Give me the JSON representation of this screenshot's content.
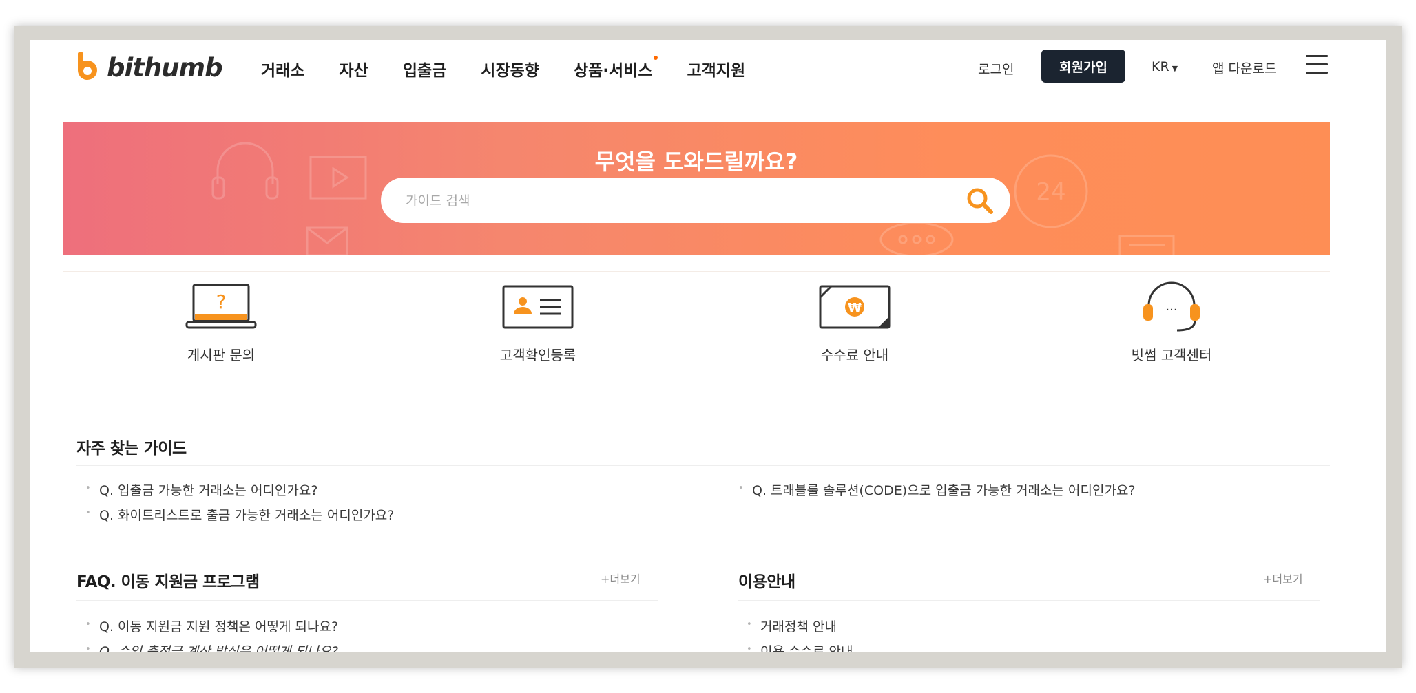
{
  "header": {
    "logo_text": "bithumb",
    "nav": [
      "거래소",
      "자산",
      "입출금",
      "시장동향",
      "상품·서비스",
      "고객지원"
    ],
    "login": "로그인",
    "join": "회원가입",
    "lang": "KR",
    "app_download": "앱 다운로드"
  },
  "banner": {
    "title": "무엇을 도와드릴까요?",
    "search_placeholder": "가이드 검색"
  },
  "quick_links": [
    {
      "label": "게시판 문의",
      "icon": "laptop-question-icon"
    },
    {
      "label": "고객확인등록",
      "icon": "id-card-icon"
    },
    {
      "label": "수수료 안내",
      "icon": "won-bill-icon"
    },
    {
      "label": "빗썸 고객센터",
      "icon": "headset-icon"
    }
  ],
  "frequent_guides": {
    "title": "자주 찾는 가이드",
    "left": [
      "Q. 입출금 가능한 거래소는 어디인가요?",
      "Q. 화이트리스트로 출금 가능한 거래소는 어디인가요?"
    ],
    "right": [
      "Q. 트래블룰 솔루션(CODE)으로 입출금 가능한 거래소는 어디인가요?"
    ]
  },
  "faq": {
    "title": "FAQ. 이동 지원금 프로그램",
    "more": "+더보기",
    "items": [
      "Q. 이동 지원금 지원 정책은 어떻게 되나요?",
      "Q. 수익 충전금 계산 방식은 어떻게 되나요?"
    ]
  },
  "usage": {
    "title": "이용안내",
    "more": "+더보기",
    "items": [
      "거래정책 안내",
      "이용 수수료 안내"
    ]
  },
  "colors": {
    "brand_orange": "#f7931e",
    "banner_start": "#ee6f7c",
    "banner_end": "#fe8e55",
    "join_button": "#1b2430"
  }
}
